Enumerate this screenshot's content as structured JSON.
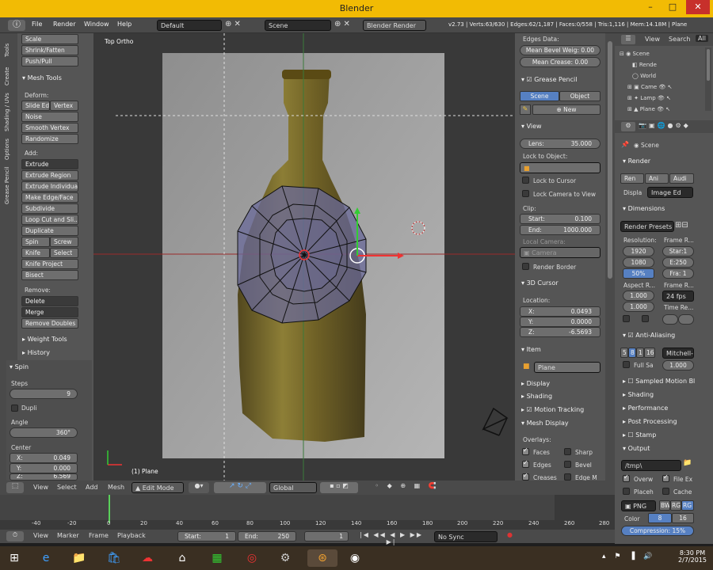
{
  "window": {
    "title": "Blender",
    "min": "–",
    "max": "□",
    "close": "✕"
  },
  "menubar": {
    "file": "File",
    "render": "Render",
    "window": "Window",
    "help": "Help",
    "layout": "Default",
    "scene": "Scene",
    "engine": "Blender Render",
    "stats": "v2.73 | Verts:63/630 | Edges:62/1,187 | Faces:0/558 | Tris:1,116 | Mem:14.18M | Plane"
  },
  "toolshelf": {
    "tabs": [
      "Tools",
      "Create",
      "Shading / UVs",
      "Options",
      "Grease Pencil"
    ],
    "top_buttons": [
      "Scale",
      "Shrink/Fatten",
      "Push/Pull"
    ],
    "mesh_tools": "Mesh Tools",
    "deform": "Deform:",
    "slide_edge": "Slide Ed",
    "vertex": "Vertex",
    "noise": "Noise",
    "smooth_vertex": "Smooth Vertex",
    "randomize": "Randomize",
    "add": "Add:",
    "extrude": "Extrude",
    "extrude_region": "Extrude Region",
    "extrude_individual": "Extrude Individual",
    "make_edge_face": "Make Edge/Face",
    "subdivide": "Subdivide",
    "loop_cut": "Loop Cut and Sli...",
    "duplicate": "Duplicate",
    "spin": "Spin",
    "screw": "Screw",
    "knife": "Knife",
    "select": "Select",
    "knife_project": "Knife Project",
    "bisect": "Bisect",
    "remove": "Remove:",
    "delete": "Delete",
    "merge": "Merge",
    "remove_doubles": "Remove Doubles",
    "weight_tools": "Weight Tools",
    "history": "History"
  },
  "spin_panel": {
    "title": "Spin",
    "steps_label": "Steps",
    "steps": "9",
    "dupli": "Dupli",
    "angle_label": "Angle",
    "angle": "360°",
    "center_label": "Center",
    "x": "X:",
    "x_val": "0.049",
    "y": "Y:",
    "y_val": "0.000",
    "z": "Z:",
    "z_val": "6.569"
  },
  "viewport": {
    "view_name": "Top Ortho",
    "object_label": "(1) Plane"
  },
  "npanel": {
    "edges_data": "Edges Data:",
    "mean_bevel": "Mean Bevel Weig: 0.00",
    "mean_crease": "Mean Crease:     0.00",
    "grease_pencil": "Grease Pencil",
    "scene_tab": "Scene",
    "object_tab": "Object",
    "new": "New",
    "view": "View",
    "lens": "Lens:",
    "lens_val": "35.000",
    "lock_to_object": "Lock to Object:",
    "lock_to_cursor": "Lock to Cursor",
    "lock_camera": "Lock Camera to View",
    "clip": "Clip:",
    "start": "Start:",
    "start_val": "0.100",
    "end": "End:",
    "end_val": "1000.000",
    "local_camera": "Local Camera:",
    "camera": "Camera",
    "render_border": "Render Border",
    "cursor_3d": "3D Cursor",
    "location": "Location:",
    "cx": "X:",
    "cx_val": "0.0493",
    "cy": "Y:",
    "cy_val": "0.0000",
    "cz": "Z:",
    "cz_val": "-6.5693",
    "item": "Item",
    "plane": "Plane",
    "display": "Display",
    "shading": "Shading",
    "motion_tracking": "Motion Tracking",
    "mesh_display": "Mesh Display",
    "overlays": "Overlays:",
    "faces": "Faces",
    "sharp": "Sharp",
    "edges": "Edges",
    "bevel": "Bevel",
    "creases": "Creases",
    "edge_m": "Edge M"
  },
  "outliner": {
    "view": "View",
    "search": "Search",
    "all": "All",
    "items": [
      "Scene",
      "Rende",
      "World",
      "Came",
      "Lamp",
      "Plane"
    ]
  },
  "properties": {
    "scene": "Scene",
    "render": "Render",
    "ren": "Ren",
    "ani": "Ani",
    "audi": "Audi",
    "display": "Displa",
    "image_ed": "Image Ed",
    "dimensions": "Dimensions",
    "render_presets": "Render Presets",
    "resolution": "Resolution:",
    "frame_range": "Frame R...",
    "res_x": "1920",
    "res_y": "1080",
    "res_pct": "50%",
    "start": "Star:1",
    "end": "E:250",
    "frame": "Fra: 1",
    "aspect": "Aspect R...",
    "frame_rate": "Frame R...",
    "asp_x": "1.000",
    "asp_y": "1.000",
    "fps": "24 fps",
    "time_re": "Time Re...",
    "anti_aliasing": "Anti-Aliasing",
    "aa_5": "5",
    "aa_8": "8",
    "aa_11": "1",
    "aa_16": "16",
    "mitchell": "Mitchell-",
    "full_sample": "Full Sa",
    "aa_size": "1.000",
    "sampled_motion": "Sampled Motion Bl",
    "shading": "Shading",
    "performance": "Performance",
    "post_processing": "Post Processing",
    "stamp": "Stamp",
    "output": "Output",
    "output_path": "/tmp\\",
    "overwrite": "Overw",
    "file_ext": "File Ex",
    "placeholders": "Placeh",
    "cache": "Cache",
    "png": "PNG",
    "bw": "BW",
    "rgb": "RG",
    "rgba": "RG",
    "color": "Color",
    "depth8": "8",
    "depth16": "16",
    "compression": "Compression:",
    "compression_val": "15%"
  },
  "vheader": {
    "view": "View",
    "select": "Select",
    "add": "Add",
    "mesh": "Mesh",
    "mode": "Edit Mode",
    "orientation": "Global"
  },
  "timeline": {
    "ticks": [
      "-40",
      "-20",
      "0",
      "20",
      "40",
      "60",
      "80",
      "100",
      "120",
      "140",
      "160",
      "180",
      "200",
      "220",
      "240",
      "260",
      "280"
    ],
    "view": "View",
    "marker": "Marker",
    "frame": "Frame",
    "playback": "Playback",
    "start": "Start:",
    "start_val": "1",
    "end": "End:",
    "end_val": "250",
    "current": "1",
    "sync": "No Sync"
  },
  "taskbar": {
    "time": "8:30 PM",
    "date": "2/7/2015"
  },
  "colors": {
    "accent": "#5680c2",
    "title": "#f2bb04",
    "mesh": "#6a6a9a"
  }
}
